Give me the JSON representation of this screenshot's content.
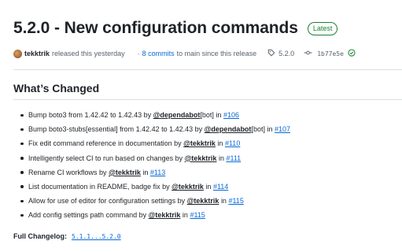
{
  "release": {
    "title": "5.2.0 - New configuration commands",
    "badge": "Latest",
    "author": "tekktrik",
    "released_text": "released this yesterday",
    "commits_text": "8 commits",
    "commits_suffix": "to main since this release",
    "tag": "5.2.0",
    "sha": "1b77e5e"
  },
  "section": {
    "title": "What’s Changed"
  },
  "changes": [
    {
      "text": "Bump boto3 from 1.42.42 to 1.42.43 by",
      "mention": "@dependabot",
      "after": "[bot] in",
      "pr": "#106"
    },
    {
      "text": "Bump boto3-stubs[essential] from 1.42.42 to 1.42.43 by",
      "mention": "@dependabot",
      "after": "[bot] in",
      "pr": "#107"
    },
    {
      "text": "Fix edit command reference in documentation by",
      "mention": "@tekktrik",
      "after": "in",
      "pr": "#110"
    },
    {
      "text": "Intelligently select CI to run based on changes by",
      "mention": "@tekktrik",
      "after": "in",
      "pr": "#111"
    },
    {
      "text": "Rename CI workflows by",
      "mention": "@tekktrik",
      "after": "in",
      "pr": "#113"
    },
    {
      "text": "List documentation in README, badge fix by",
      "mention": "@tekktrik",
      "after": "in",
      "pr": "#114"
    },
    {
      "text": "Allow for use of editor for configuration settings by",
      "mention": "@tekktrik",
      "after": "in",
      "pr": "#115"
    },
    {
      "text": "Add config settings path command by",
      "mention": "@tekktrik",
      "after": "in",
      "pr": "#115"
    }
  ],
  "full_changelog": {
    "label": "Full Changelog:",
    "link": "5.1.1...5.2.0"
  },
  "icons": {
    "tag": "tag-icon",
    "commit": "git-commit-icon",
    "check": "check-circle-icon",
    "avatar": "avatar"
  },
  "colors": {
    "link": "#0969da",
    "badge": "#1a7f37",
    "text": "#1f2328",
    "muted": "#59636e"
  }
}
